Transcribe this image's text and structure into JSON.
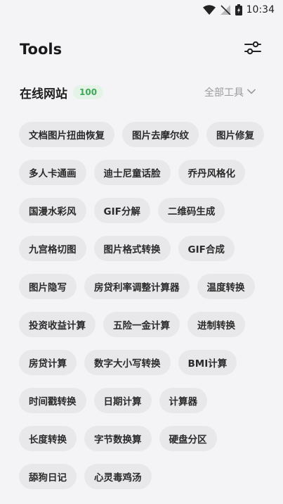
{
  "status_bar": {
    "time": "10:34"
  },
  "header": {
    "title": "Tools"
  },
  "section": {
    "title": "在线网站",
    "count": "100",
    "filter_label": "全部工具"
  },
  "tools": [
    "文档图片扭曲恢复",
    "图片去摩尔纹",
    "图片修复",
    "多人卡通画",
    "迪士尼童话脸",
    "乔丹风格化",
    "国漫水彩风",
    "GIF分解",
    "二维码生成",
    "九宫格切图",
    "图片格式转换",
    "GIF合成",
    "图片隐写",
    "房贷利率调整计算器",
    "温度转换",
    "投资收益计算",
    "五险一金计算",
    "进制转换",
    "房贷计算",
    "数字大小写转换",
    "BMI计算",
    "时间戳转换",
    "日期计算",
    "计算器",
    "长度转换",
    "字节数换算",
    "硬盘分区",
    "舔狗日记",
    "心灵毒鸡汤"
  ],
  "colors": {
    "badge_bg": "#e3f4e6",
    "badge_text": "#3ea857",
    "chip_bg": "#e8e8ea",
    "page_bg": "#f4f4f6"
  }
}
